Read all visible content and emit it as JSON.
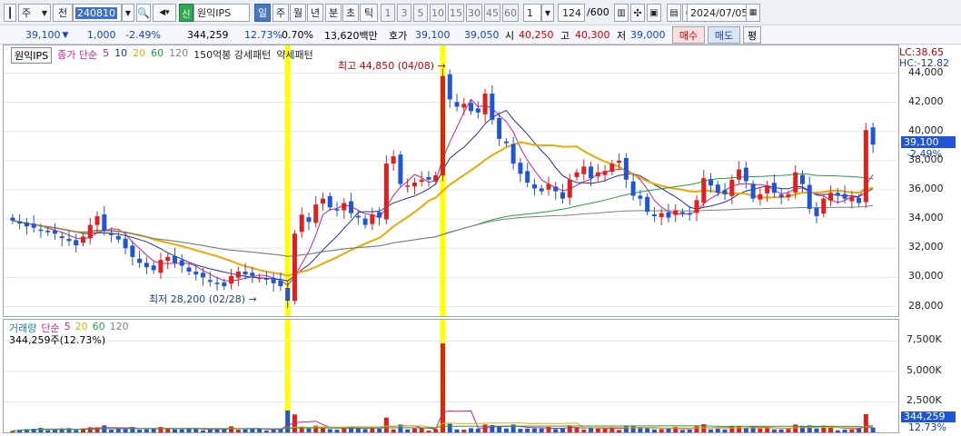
{
  "toolbar": {
    "market": "주",
    "prev": "전",
    "code": "240810",
    "stock_badge": "신",
    "stock_name": "원익IPS",
    "periods": [
      "일",
      "주",
      "월",
      "년",
      "분",
      "초",
      "틱"
    ],
    "period_selected": "일",
    "intervals": [
      "1",
      "3",
      "5",
      "10",
      "15",
      "30",
      "45",
      "60"
    ],
    "unit_value": "1",
    "count": "124",
    "count_total": "/600",
    "date": "2024/07/05"
  },
  "quote": {
    "price": "39,100",
    "change": "1,000",
    "change_pct": "-2.49%",
    "volume": "344,259",
    "volume_ratio": "12.73%",
    "turnover_pct": "0.70%",
    "amount": "13,620백만",
    "ask_label": "호가",
    "ask": "39,100",
    "bid": "39,050",
    "open_label": "시",
    "open": "40,250",
    "high_label": "고",
    "high": "40,300",
    "low_label": "저",
    "low": "39,000",
    "buy_label": "매수",
    "sell_label": "매도",
    "eval_label": "평"
  },
  "main_legend": {
    "name": "원익IPS",
    "ma_label": "종가 단순",
    "ma_periods": [
      "5",
      "10",
      "20",
      "60",
      "120"
    ],
    "pattern1": "150억봉 강세패턴",
    "pattern2": "약세패턴"
  },
  "vol_legend": {
    "title": "거래량",
    "ma_label": "단순",
    "ma_periods": [
      "5",
      "20",
      "60",
      "120"
    ],
    "current": "344,259주(12.73%)"
  },
  "annotations": {
    "high": "최고 44,850 (04/08)",
    "low": "최저 28,200 (02/28)"
  },
  "price_axis": {
    "lc": "LC:38.65",
    "hc": "HC:-12.82",
    "ticks": [
      "44,000",
      "42,000",
      "40,000",
      "38,000",
      "36,000",
      "34,000",
      "32,000",
      "30,000",
      "28,000"
    ],
    "current_price": "39,100",
    "current_change": "-2.49%"
  },
  "vol_axis": {
    "ticks": [
      "7,500K",
      "5,000K",
      "2,500K"
    ],
    "current": "344,259",
    "current_pct": "12.73%"
  },
  "colors": {
    "up": "#e0201c",
    "down": "#1f55d6",
    "ma5": "#d02090",
    "ma10": "#2030a0",
    "ma20": "#f0a800",
    "ma60": "#20a040",
    "ma120": "#808080",
    "highlight": "#ffff00"
  },
  "chart_data": {
    "type": "candlestick",
    "ylim": [
      27000,
      46000
    ],
    "dates_marked": {
      "high": "04/08",
      "low": "02/28"
    },
    "ohlc_close_approx": [
      33900,
      33700,
      33500,
      33400,
      33200,
      33100,
      33000,
      32700,
      32500,
      32200,
      32800,
      33600,
      34200,
      33200,
      32900,
      32600,
      32000,
      31400,
      31000,
      30700,
      30500,
      31200,
      31400,
      31000,
      30800,
      30400,
      30200,
      30000,
      29700,
      29600,
      29400,
      30100,
      30400,
      30200,
      30100,
      30000,
      29900,
      29600,
      29400,
      28400,
      33000,
      34300,
      33800,
      35000,
      35400,
      34800,
      34600,
      35100,
      34400,
      34100,
      33600,
      34300,
      34100,
      37800,
      38300,
      36400,
      36300,
      36500,
      36700,
      36700,
      37000,
      43800,
      42200,
      41700,
      41900,
      41400,
      41300,
      42600,
      40800,
      39500,
      39200,
      37800,
      37100,
      36500,
      36100,
      35900,
      36400,
      35900,
      35400,
      36700,
      37200,
      37600,
      36800,
      37200,
      37300,
      37800,
      38000,
      36700,
      35600,
      35400,
      34500,
      34200,
      34400,
      34100,
      34600,
      34400,
      34300,
      35300,
      36800,
      36300,
      35800,
      35700,
      36700,
      37400,
      36600,
      35400,
      35700,
      36300,
      35800,
      35500,
      35700,
      37200,
      36400,
      34700,
      34200,
      35400,
      35800,
      35600,
      35400,
      35500,
      35100,
      40100,
      39100
    ],
    "volume_peaks_k": {
      "spike1": 1800,
      "spike2": 7300,
      "last": 1500
    }
  }
}
